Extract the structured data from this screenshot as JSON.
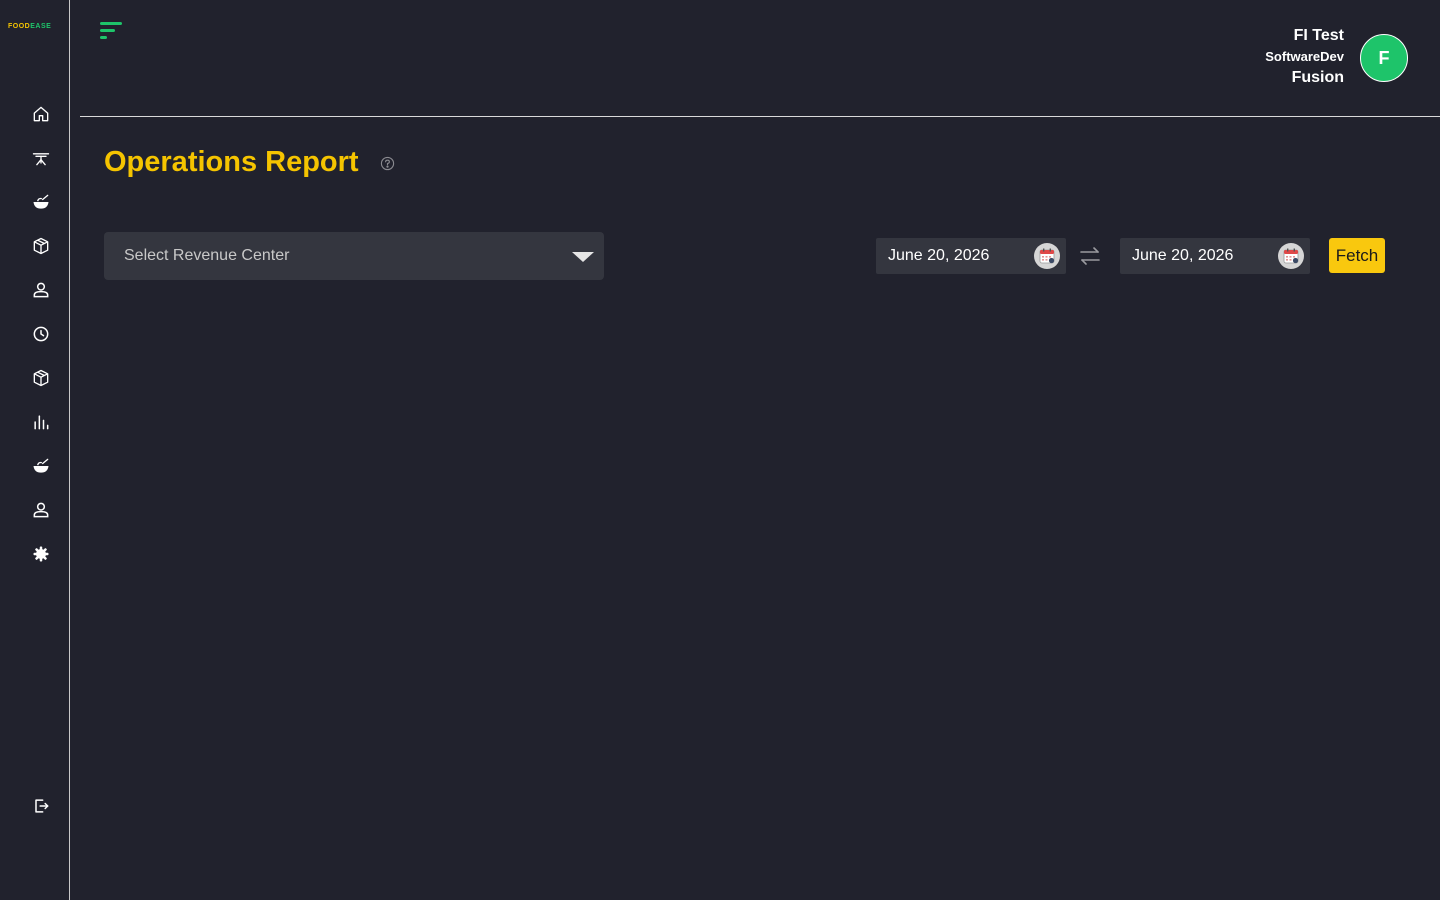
{
  "brand": {
    "logo_part1": "FOOD",
    "logo_part2": "EASE"
  },
  "sidebar": {
    "items": [
      {
        "icon": "home-icon"
      },
      {
        "icon": "dining-table-icon"
      },
      {
        "icon": "food-bowl-icon"
      },
      {
        "icon": "box-icon"
      },
      {
        "icon": "user-icon"
      },
      {
        "icon": "clock-icon"
      },
      {
        "icon": "box-icon"
      },
      {
        "icon": "bar-chart-icon"
      },
      {
        "icon": "food-bowl-icon"
      },
      {
        "icon": "user-icon"
      },
      {
        "icon": "gear-icon"
      }
    ],
    "logout_icon": "logout-icon"
  },
  "header": {
    "user_name": "FI Test",
    "org_line1": "SoftwareDev",
    "org_line2": "Fusion",
    "avatar_initial": "F"
  },
  "main": {
    "title": "Operations Report",
    "revenue_center": {
      "placeholder": "Select Revenue Center"
    },
    "date_from": "June 20, 2026",
    "date_to": "June 20, 2026",
    "fetch_label": "Fetch"
  },
  "colors": {
    "background": "#21222d",
    "accent_yellow": "#f5c400",
    "accent_green": "#1ec46a",
    "field_bg": "#34363f"
  }
}
